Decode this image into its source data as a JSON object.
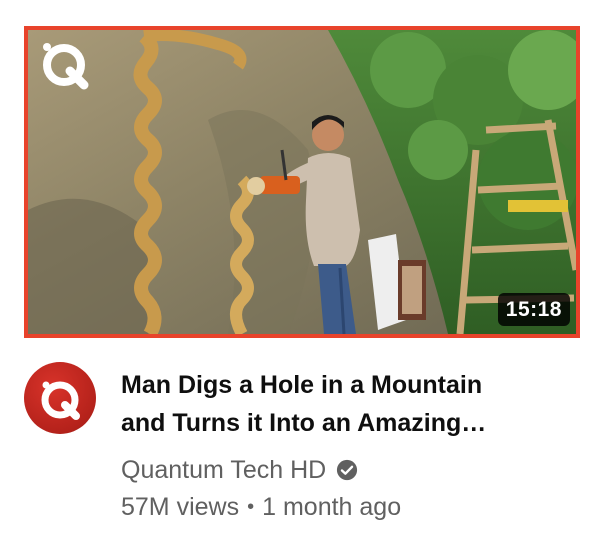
{
  "video": {
    "duration": "15:18",
    "title_line1": "Man Digs a Hole in a Mountain",
    "title_line2": "and Turns it Into an Amazing…",
    "thumbnail_icon": "scene-image",
    "brand_watermark_icon": "q-logo-icon"
  },
  "channel": {
    "name": "Quantum Tech HD",
    "avatar_icon": "q-logo-icon",
    "verified_icon": "verified-check-icon"
  },
  "stats": {
    "views": "57M views",
    "separator": "•",
    "age": "1 month ago"
  },
  "colors": {
    "thumbnail_border": "#e8432b",
    "avatar_red": "#c4271f",
    "title_text": "#0f0f0f",
    "secondary_text": "#606060",
    "duration_bg": "#000000"
  }
}
